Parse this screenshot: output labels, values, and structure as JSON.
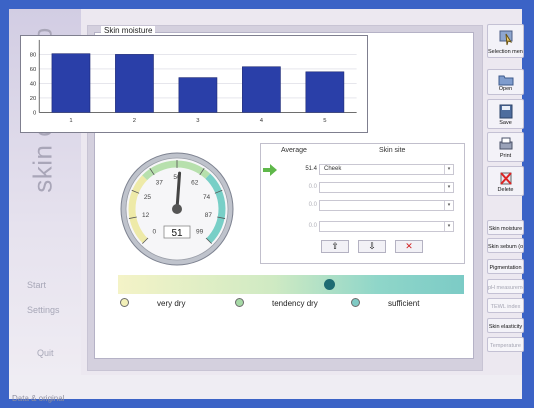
{
  "app": {
    "brand_title": "skin check-up",
    "status_text": "Data & original",
    "accent_color": "#3b63c6"
  },
  "left_nav": {
    "start": "Start",
    "settings": "Settings",
    "quit": "Quit"
  },
  "panel": {
    "title": "Skin moisture"
  },
  "chart_data": {
    "type": "bar",
    "categories": [
      "1",
      "2",
      "3",
      "4",
      "5"
    ],
    "values": [
      81,
      80,
      48,
      63,
      56
    ],
    "y_ticks": [
      "0",
      "20",
      "40",
      "60",
      "80"
    ],
    "ylim": [
      0,
      100
    ],
    "grid": true,
    "bar_color": "#2a3fa8"
  },
  "gauge": {
    "value": "51",
    "ticks": [
      "0",
      "12",
      "25",
      "37",
      "50",
      "62",
      "74",
      "87",
      "99"
    ],
    "needle_value": 51
  },
  "measure_table": {
    "header_average": "Average",
    "header_site": "Skin site",
    "rows": [
      {
        "value": "51.4",
        "site": "Cheek",
        "active": true
      },
      {
        "value": "0.0",
        "site": "",
        "active": false
      },
      {
        "value": "0.0",
        "site": "",
        "active": false
      },
      {
        "value": "0.0",
        "site": "",
        "active": false
      }
    ],
    "buttons": {
      "up": "⇧",
      "down": "⇩",
      "delete": "✕"
    }
  },
  "scale": {
    "marker_fraction": 0.61,
    "legend": [
      "very dry",
      "tendency dry",
      "sufficient"
    ],
    "legend_colors": [
      "#f2f0b8",
      "#a6d9a6",
      "#7fcac4"
    ]
  },
  "right_toolbar": {
    "selection_menu": "Selection menu",
    "open": "Open",
    "save": "Save",
    "print": "Print",
    "delete": "Delete",
    "skin_moisture": "Skin moisture",
    "skin_sebum": "Skin sebum (oil)",
    "pigmentation": "Pigmentation",
    "ph_measurement": "pH measurement",
    "tewl_index": "TEWL index",
    "skin_elasticity": "Skin elasticity",
    "temperature": "Temperature"
  }
}
